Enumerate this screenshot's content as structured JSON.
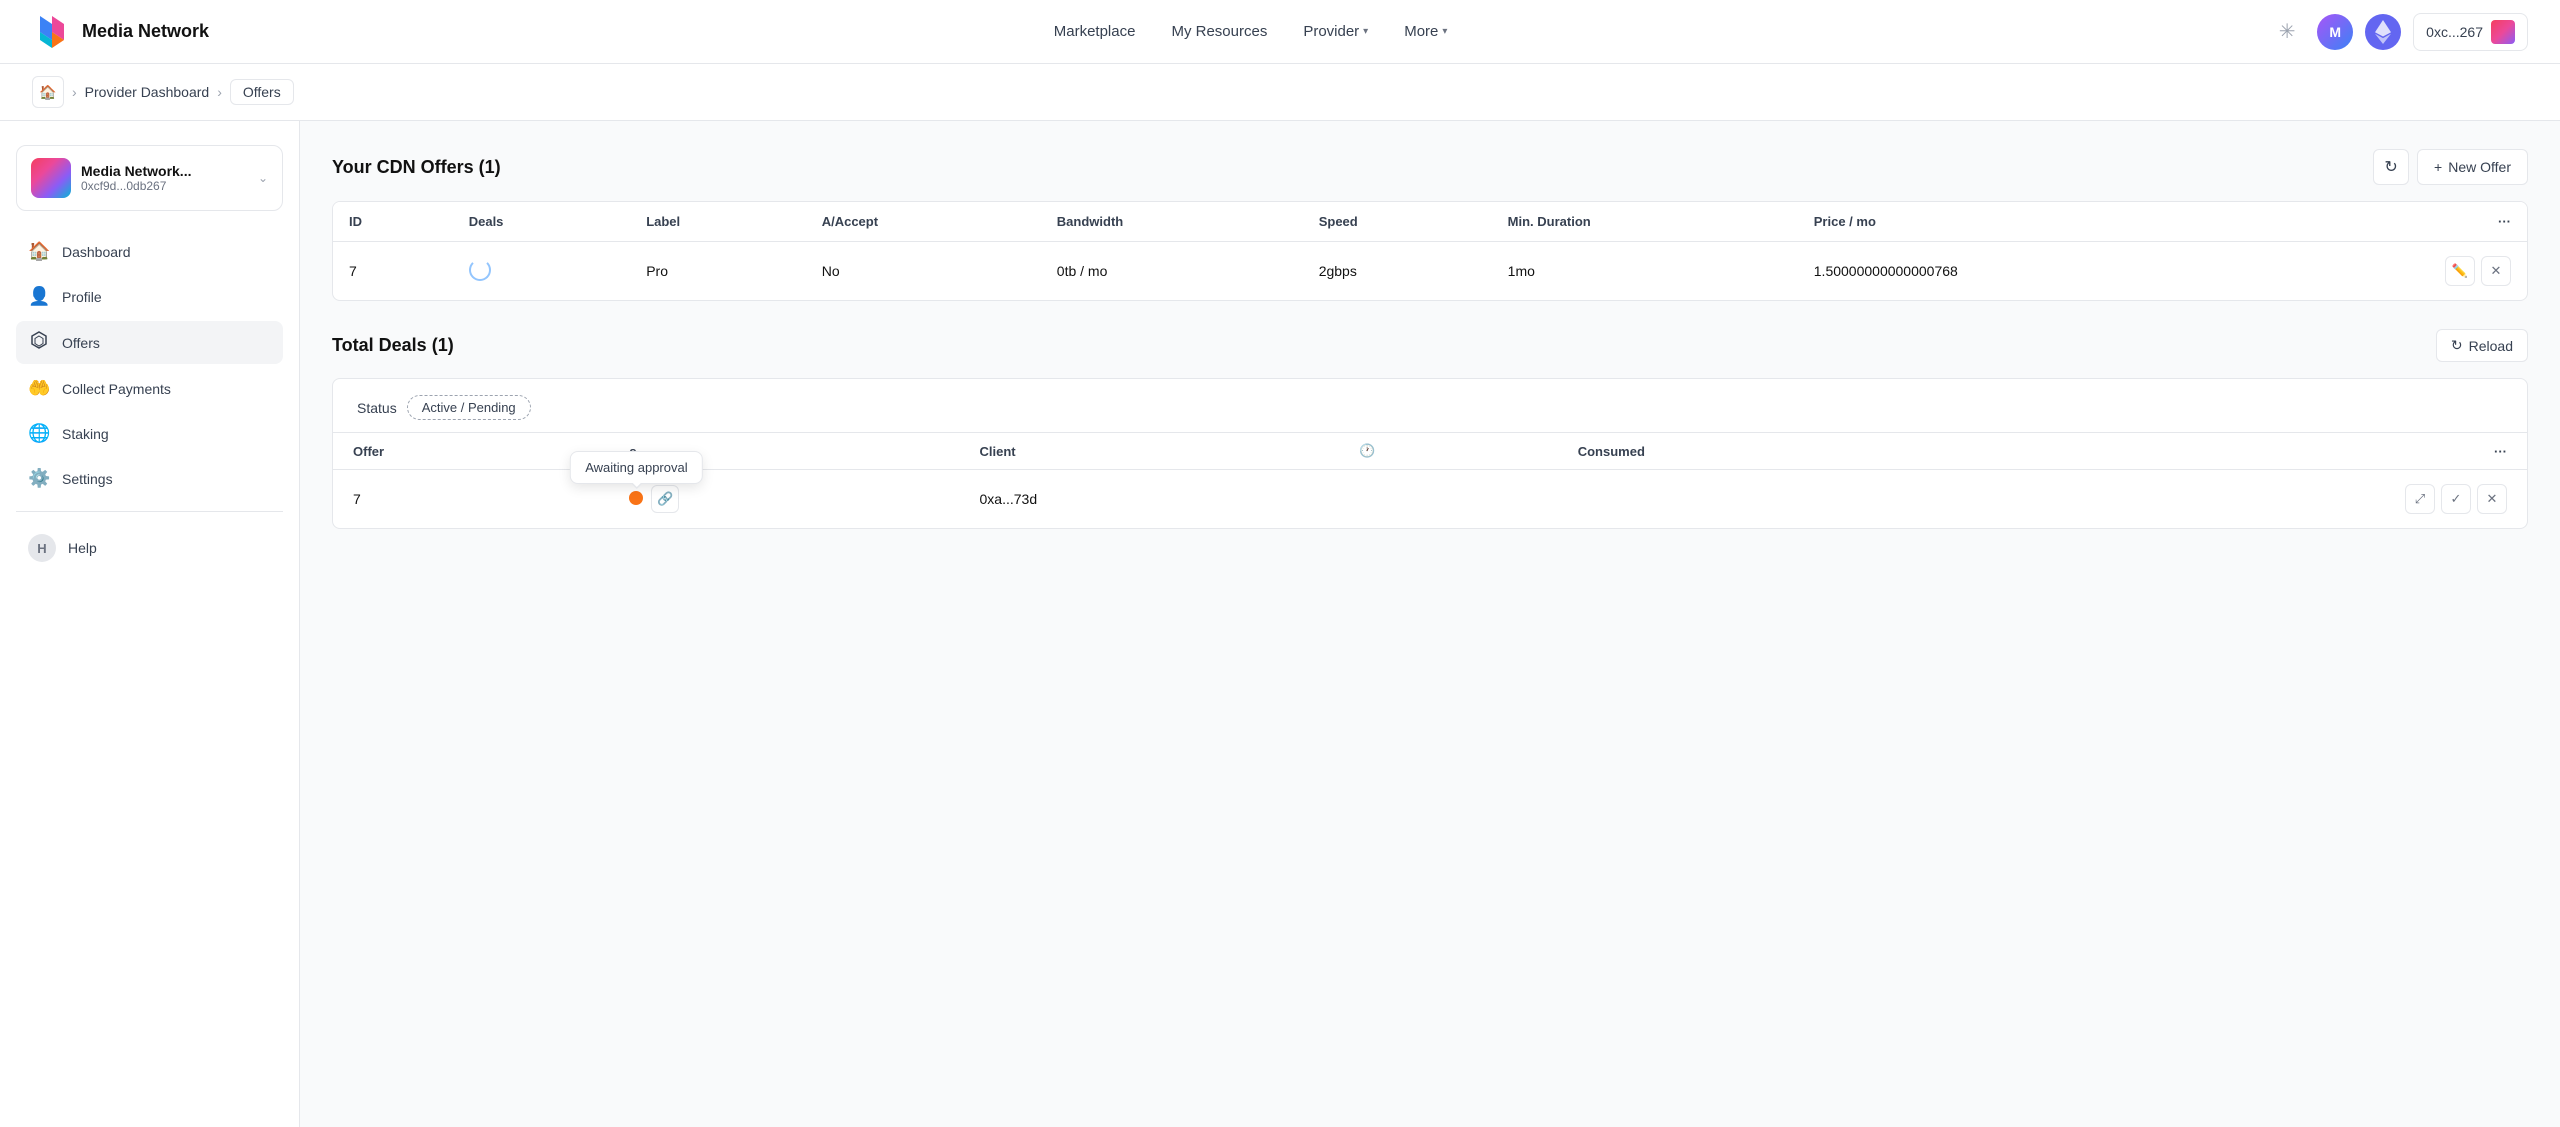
{
  "app": {
    "title": "Media Network"
  },
  "header": {
    "logo_text": "Media Network",
    "nav_items": [
      {
        "label": "Marketplace",
        "has_chevron": false
      },
      {
        "label": "My Resources",
        "has_chevron": false
      },
      {
        "label": "Provider",
        "has_chevron": true
      },
      {
        "label": "More",
        "has_chevron": true
      }
    ],
    "wallet_address": "0xc...267"
  },
  "breadcrumb": {
    "home": "home",
    "items": [
      {
        "label": "Provider Dashboard",
        "active": false
      },
      {
        "label": "Offers",
        "active": true
      }
    ]
  },
  "sidebar": {
    "account": {
      "name": "Media Network...",
      "address": "0xcf9d...0db267"
    },
    "nav_items": [
      {
        "id": "dashboard",
        "label": "Dashboard",
        "icon": "🏠"
      },
      {
        "id": "profile",
        "label": "Profile",
        "icon": "👤"
      },
      {
        "id": "offers",
        "label": "Offers",
        "icon": "⬡",
        "active": true
      },
      {
        "id": "collect-payments",
        "label": "Collect Payments",
        "icon": "🤲"
      },
      {
        "id": "staking",
        "label": "Staking",
        "icon": "🌐"
      },
      {
        "id": "settings",
        "label": "Settings",
        "icon": "⚙️"
      },
      {
        "id": "help",
        "label": "Help",
        "icon": "H"
      }
    ]
  },
  "cdn_offers": {
    "title": "Your CDN Offers (1)",
    "refresh_label": "↻",
    "new_offer_label": "+ New Offer",
    "columns": [
      "ID",
      "Deals",
      "Label",
      "A/Accept",
      "Bandwidth",
      "Speed",
      "Min. Duration",
      "Price / mo",
      "..."
    ],
    "rows": [
      {
        "id": "7",
        "deals": "loading",
        "label": "Pro",
        "a_accept": "No",
        "bandwidth": "0tb / mo",
        "speed": "2gbps",
        "min_duration": "1mo",
        "price": "1.50000000000000768"
      }
    ]
  },
  "total_deals": {
    "title": "Total Deals (1)",
    "reload_label": "Reload",
    "status_label": "Status",
    "status_filter": "Active / Pending",
    "tooltip": "Awaiting approval",
    "columns": [
      "Offer",
      "s",
      "Client",
      "clock",
      "Consumed",
      "..."
    ],
    "rows": [
      {
        "offer": "7",
        "status_dot": "orange",
        "client": "0xa...73d"
      }
    ]
  }
}
